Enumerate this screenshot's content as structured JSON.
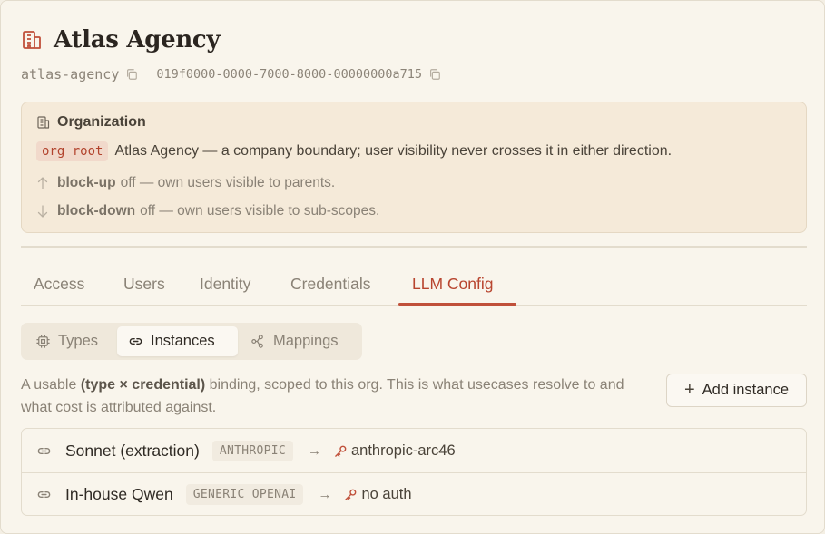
{
  "header": {
    "title": "Atlas Agency",
    "slug": "atlas-agency",
    "uuid": "019f0000-0000-7000-8000-00000000a715"
  },
  "org_box": {
    "heading": "Organization",
    "badge": "org root",
    "description": "Atlas Agency — a company boundary; user visibility never crosses it in either direction.",
    "block_up": {
      "label": "block-up",
      "text": "off — own users visible to parents."
    },
    "block_down": {
      "label": "block-down",
      "text": "off — own users visible to sub-scopes."
    }
  },
  "tabs": [
    {
      "label": "Access"
    },
    {
      "label": "Users"
    },
    {
      "label": "Identity"
    },
    {
      "label": "Credentials"
    },
    {
      "label": "LLM Config",
      "active": true
    }
  ],
  "subnav": [
    {
      "label": "Types",
      "icon": "chip-icon"
    },
    {
      "label": "Instances",
      "icon": "link-icon",
      "active": true
    },
    {
      "label": "Mappings",
      "icon": "flow-icon"
    }
  ],
  "description": {
    "prefix": "A usable ",
    "bold": "(type × credential)",
    "suffix": " binding, scoped to this org. This is what usecases resolve to and what cost is attributed against."
  },
  "add_button": {
    "label": "Add instance"
  },
  "instances": [
    {
      "name": "Sonnet (extraction)",
      "type": "ANTHROPIC",
      "credential": "anthropic-arc46"
    },
    {
      "name": "In-house Qwen",
      "type": "GENERIC OPENAI",
      "credential": "no auth"
    }
  ],
  "colors": {
    "accent": "#c0503a",
    "background": "#f9f5ec",
    "org_box": "#f5ead9"
  }
}
